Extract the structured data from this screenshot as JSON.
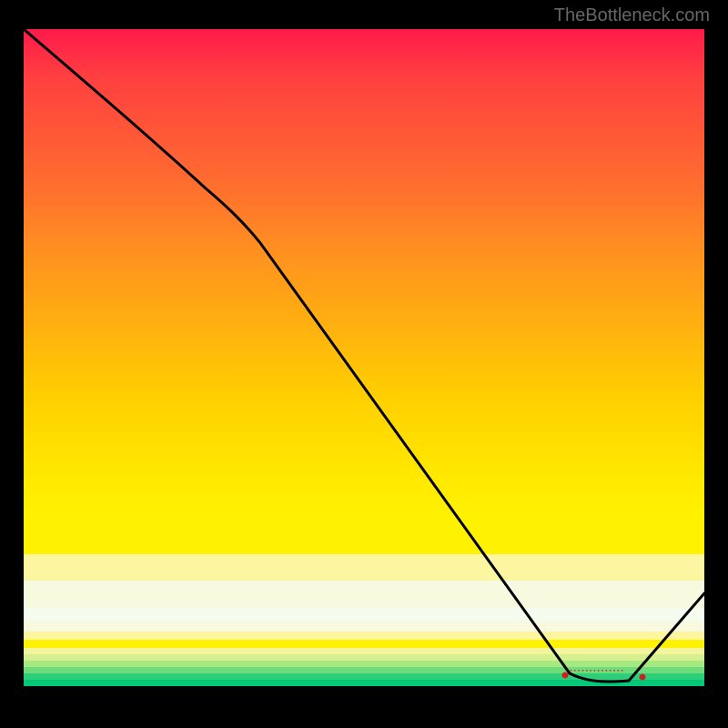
{
  "watermark": "TheBottleneck.com",
  "annotation_text": "··············",
  "chart_data": {
    "type": "line",
    "title": "",
    "xlabel": "",
    "ylabel": "",
    "xlim": [
      0,
      100
    ],
    "ylim": [
      0,
      100
    ],
    "series": [
      {
        "name": "curve",
        "x": [
          0,
          27,
          80,
          88,
          100
        ],
        "y": [
          100,
          76,
          2,
          1,
          14
        ]
      }
    ],
    "markers": [
      {
        "name": "minimum-range-start",
        "x": 80,
        "y": 1
      },
      {
        "name": "minimum-range-end",
        "x": 90,
        "y": 1
      }
    ],
    "background_gradient_stops": [
      {
        "pos": 0.0,
        "color": "#ff1a4a"
      },
      {
        "pos": 0.5,
        "color": "#ffb010"
      },
      {
        "pos": 0.75,
        "color": "#fff200"
      },
      {
        "pos": 0.85,
        "color": "#f8fae0"
      },
      {
        "pos": 1.0,
        "color": "#00c878"
      }
    ]
  }
}
